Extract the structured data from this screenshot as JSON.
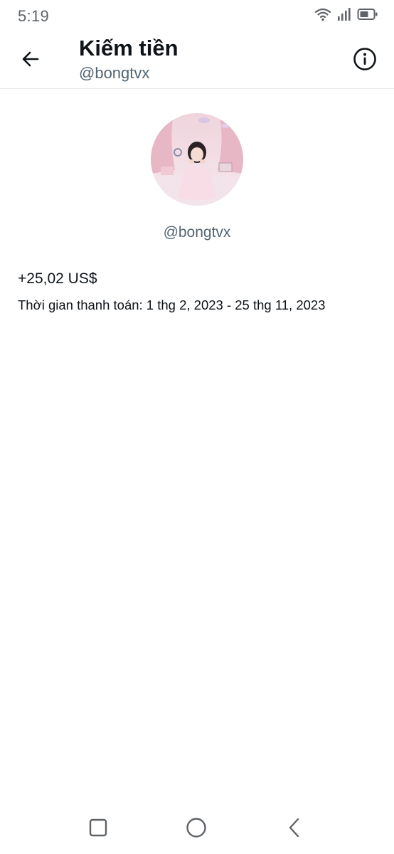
{
  "status_bar": {
    "time": "5:19",
    "icons": [
      "wifi-icon",
      "signal-icon",
      "battery-icon"
    ]
  },
  "header": {
    "title": "Kiếm tiền",
    "subtitle": "@bongtvx",
    "back_icon": "arrow-left-icon",
    "info_icon": "info-icon"
  },
  "profile": {
    "handle": "@bongtvx",
    "avatar": "profile-photo"
  },
  "earnings": {
    "amount": "+25,02 US$",
    "period": "Thời gian thanh toán: 1 thg 2, 2023 - 25 thg 11, 2023"
  },
  "nav_bar": {
    "icons": [
      "recents-square-icon",
      "home-circle-icon",
      "back-chevron-icon"
    ]
  },
  "colors": {
    "primary_text": "#0f1419",
    "secondary_text": "#536471",
    "divider": "#e6e9ec",
    "status_gray": "#5f6368"
  }
}
